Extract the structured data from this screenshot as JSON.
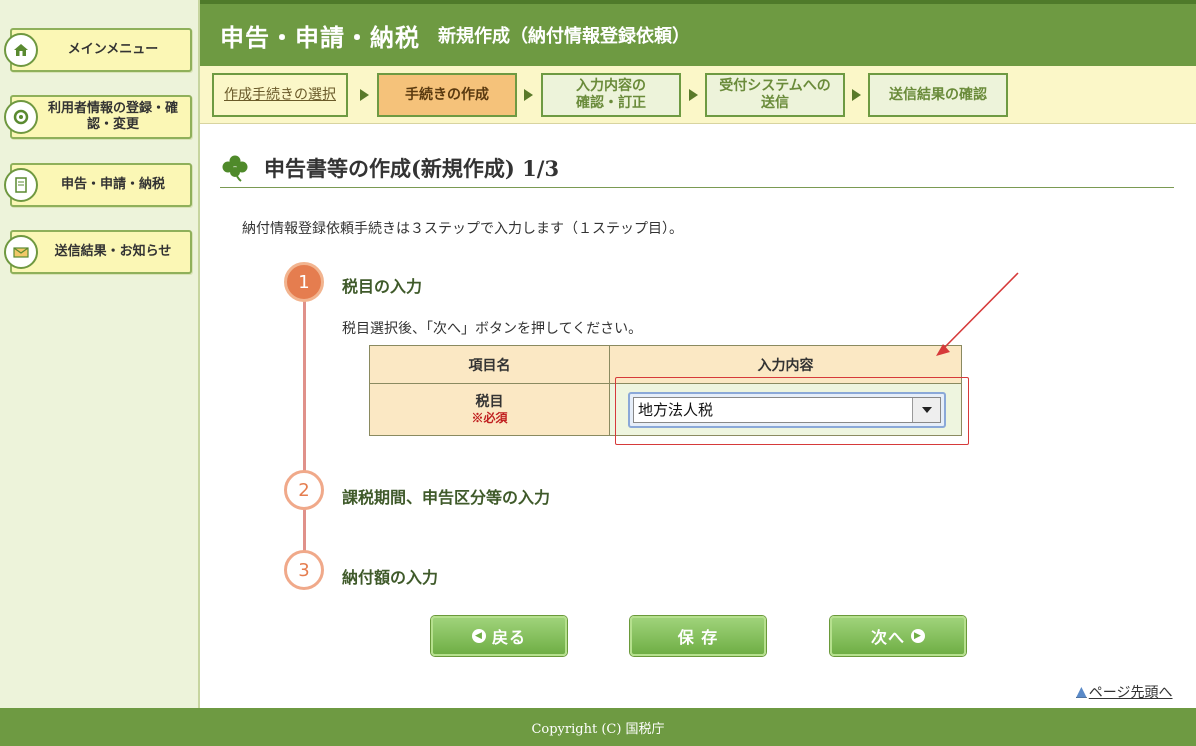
{
  "sidebar": {
    "items": [
      {
        "label": "メインメニュー",
        "icon": "home-icon"
      },
      {
        "label": "利用者情報の登録・確認・変更",
        "icon": "user-settings-icon"
      },
      {
        "label": "申告・申請・納税",
        "icon": "document-icon"
      },
      {
        "label": "送信結果・お知らせ",
        "icon": "mail-icon"
      }
    ]
  },
  "header": {
    "title": "申告・申請・納税",
    "subtitle": "新規作成（納付情報登録依頼）"
  },
  "steps": [
    {
      "line1": "作成手続きの選択",
      "line2": "",
      "state": "link"
    },
    {
      "line1": "手続きの作成",
      "line2": "",
      "state": "active"
    },
    {
      "line1": "入力内容の",
      "line2": "確認・訂正",
      "state": "inactive"
    },
    {
      "line1": "受付システムへの",
      "line2": "送信",
      "state": "inactive"
    },
    {
      "line1": "送信結果の確認",
      "line2": "",
      "state": "inactive"
    }
  ],
  "main": {
    "heading": "申告書等の作成(新規作成) 1/3",
    "intro": "納付情報登録依頼手続きは３ステップで入力します（１ステップ目）。",
    "timeline": [
      {
        "num": "1",
        "label": "税目の入力"
      },
      {
        "num": "2",
        "label": "課税期間、申告区分等の入力"
      },
      {
        "num": "3",
        "label": "納付額の入力"
      }
    ],
    "instruction": "税目選択後、「次へ」ボタンを押してください。",
    "table": {
      "col1": "項目名",
      "col2": "入力内容",
      "row_label": "税目",
      "row_required": "※必須",
      "select_value": "地方法人税"
    }
  },
  "buttons": {
    "back": "戻る",
    "save": "保 存",
    "next": "次へ"
  },
  "page_top": "ページ先頭へ",
  "footer": "Copyright (C) 国税庁",
  "colors": {
    "header_green": "#6e9a42",
    "step_active": "#f5c27a",
    "timeline_orange": "#e57d4f",
    "highlight_red": "#d63a3a"
  }
}
